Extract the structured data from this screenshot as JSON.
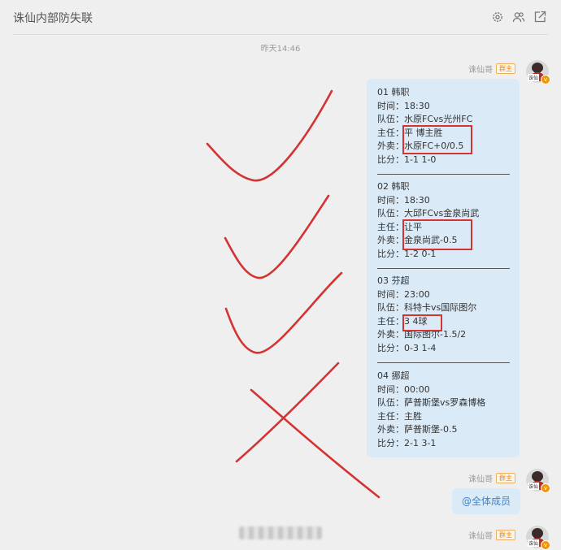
{
  "header": {
    "title": "诛仙内部防失联",
    "icons": [
      "gear-icon",
      "members-icon",
      "share-icon"
    ]
  },
  "timestamp": "昨天14:46",
  "sender": {
    "name": "诛仙哥",
    "badge": "群主",
    "avatar_tag": "诛仙"
  },
  "matches": [
    {
      "header": "01 韩职",
      "time_label": "时间：",
      "time": "18:30",
      "teams_label": "队伍：",
      "teams": "水原FCvs光州FC",
      "main_label": "主任：",
      "main": "平 博主胜",
      "sell_label": "外卖：",
      "sell": "水原FC+0/0.5",
      "score_label": "比分：",
      "score": "1-1 1-0"
    },
    {
      "header": "02 韩职",
      "time_label": "时间：",
      "time": "18:30",
      "teams_label": "队伍：",
      "teams": "大邱FCvs金泉尚武",
      "main_label": "主任：",
      "main": "让平",
      "sell_label": "外卖：",
      "sell": "金泉尚武-0.5",
      "score_label": "比分：",
      "score": "1-2 0-1"
    },
    {
      "header": "03 芬超",
      "time_label": "时间：",
      "time": "23:00",
      "teams_label": "队伍：",
      "teams": "科特卡vs国际图尔",
      "main_label": "主任：",
      "main": "3 4球",
      "sell_label": "外卖：",
      "sell": "国际图尔-1.5/2",
      "score_label": "比分：",
      "score": "0-3 1-4"
    },
    {
      "header": "04 挪超",
      "time_label": "时间：",
      "time": "00:00",
      "teams_label": "队伍：",
      "teams": "萨普斯堡vs罗森博格",
      "main_label": "主任：",
      "main": "主胜",
      "sell_label": "外卖：",
      "sell": "萨普斯堡-0.5",
      "score_label": "比分：",
      "score": "2-1 3-1"
    }
  ],
  "mention": "@全体成员",
  "annotation_color": "#d43333"
}
